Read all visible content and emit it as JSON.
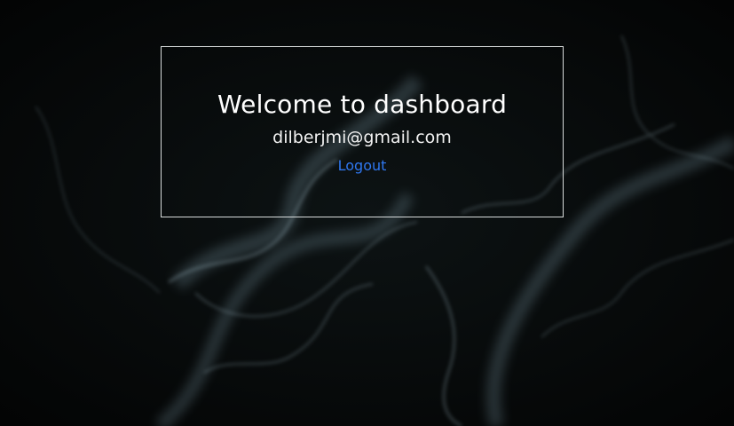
{
  "dashboard": {
    "title": "Welcome to dashboard",
    "email": "dilberjmi@gmail.com",
    "logout_label": "Logout"
  },
  "colors": {
    "background": "#070909",
    "card_border": "#d8dcdc",
    "title_text": "#ffffff",
    "link": "#2f77f0",
    "smoke": "#8fb0bf"
  }
}
